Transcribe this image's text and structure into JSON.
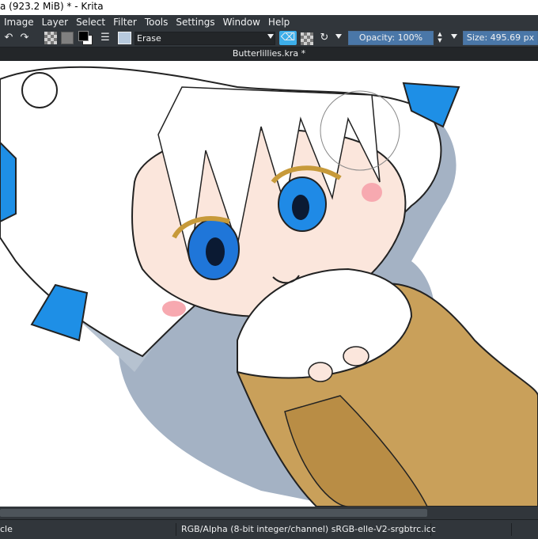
{
  "window": {
    "title": "a (923.2 MiB)  * - Krita"
  },
  "menu": {
    "items": [
      "Image",
      "Layer",
      "Select",
      "Filter",
      "Tools",
      "Settings",
      "Window",
      "Help"
    ]
  },
  "tool_options": {
    "preset_label": "Erase",
    "opacity_label": "Opacity: 100%",
    "opacity_value": 100,
    "size_label": "Size: 495.69 px"
  },
  "document": {
    "tab_title": "Butterlillies.kra *"
  },
  "statusbar": {
    "tool_text": "cle",
    "color_mode": "RGB/Alpha (8-bit integer/channel)  sRGB-elle-V2-srgbtrc.icc"
  },
  "icons": {
    "undo": "undo-icon",
    "redo": "redo-icon",
    "pattern": "pattern-icon",
    "gradient": "gradient-icon",
    "fg_bg": "fg-bg-color-icon",
    "settings": "brush-settings-icon",
    "preset": "brush-preset-icon",
    "eraser": "eraser-icon",
    "alpha_lock": "alpha-lock-icon",
    "reload": "reload-preset-icon"
  },
  "colors": {
    "chrome": "#31363b",
    "highlight": "#3daee9",
    "slider": "#3b5f86"
  }
}
